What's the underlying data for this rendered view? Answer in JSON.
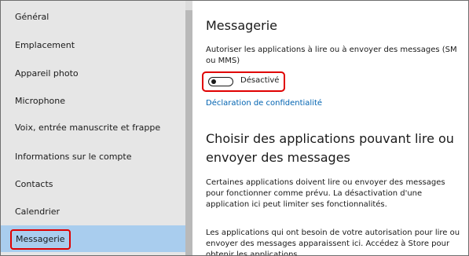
{
  "sidebar": {
    "items": [
      {
        "label": "Général",
        "selected": false
      },
      {
        "label": "Emplacement",
        "selected": false
      },
      {
        "label": "Appareil photo",
        "selected": false
      },
      {
        "label": "Microphone",
        "selected": false
      },
      {
        "label": "Voix, entrée manuscrite et frappe",
        "selected": false
      },
      {
        "label": "Informations sur le compte",
        "selected": false
      },
      {
        "label": "Contacts",
        "selected": false
      },
      {
        "label": "Calendrier",
        "selected": false
      },
      {
        "label": "Messagerie",
        "selected": true
      }
    ]
  },
  "content": {
    "title": "Messagerie",
    "description": "Autoriser les applications à lire ou à envoyer des messages (SM ou MMS)",
    "toggle": {
      "state": "off",
      "label": "Désactivé"
    },
    "privacy_link": "Déclaration de confidentialité",
    "heading2": "Choisir des applications pouvant lire ou envoyer des messages",
    "paragraph1": "Certaines applications doivent lire ou envoyer des messages pour fonctionner comme prévu. La désactivation d'une application ici peut limiter ses fonctionnalités.",
    "paragraph2": "Les applications qui ont besoin de votre autorisation pour lire ou envoyer des messages apparaissent ici. Accédez à Store pour obtenir les applications."
  },
  "colors": {
    "sidebar_bg": "#e6e6e6",
    "selected_bg": "#a9cdee",
    "highlight_red": "#e00000",
    "link_blue": "#0063b1"
  }
}
